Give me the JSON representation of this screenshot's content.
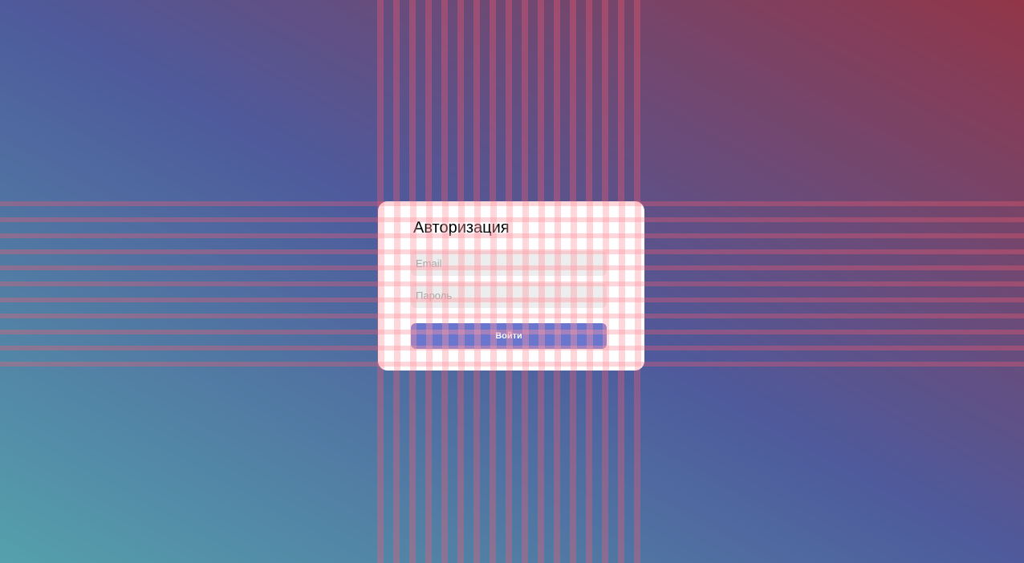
{
  "login_form": {
    "title": "Авторизация",
    "email_placeholder": "Email",
    "email_value": "",
    "password_placeholder": "Пароль",
    "password_value": "",
    "submit_label": "Войти"
  },
  "colors": {
    "background_gradient": [
      "#55a0ac",
      "#4e5a9c",
      "#923648"
    ],
    "card_background": "#ffffff",
    "input_background": "#ededed",
    "button_background": "#6a75ce",
    "button_text": "#ffffff",
    "grid_overlay": "#ff5a6e"
  }
}
